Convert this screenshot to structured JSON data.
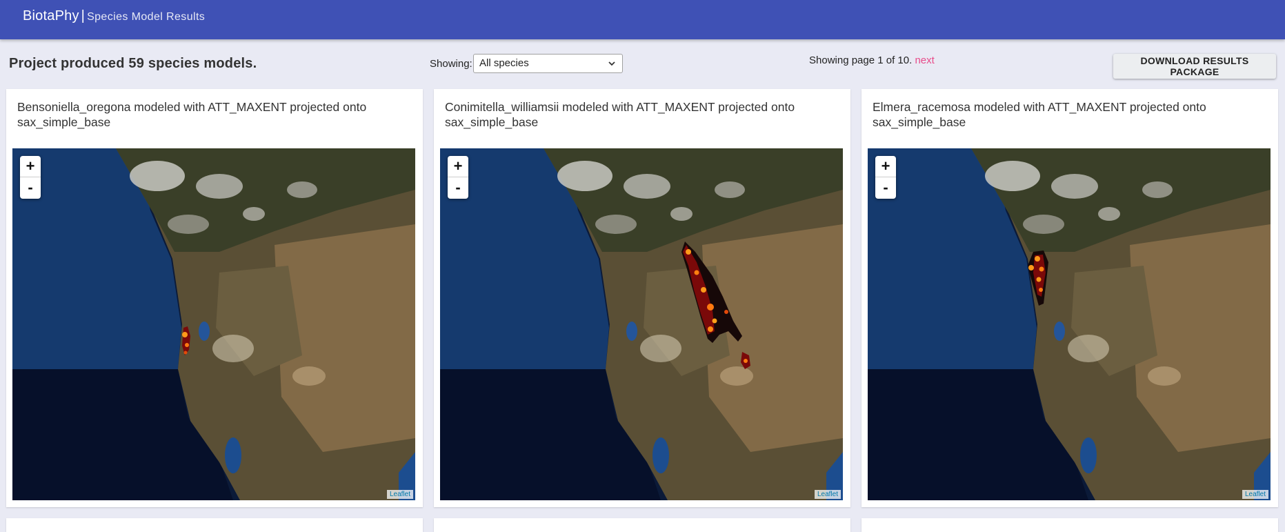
{
  "header": {
    "brand": "BiotaPhy",
    "separator": "|",
    "subtitle": "Species Model Results"
  },
  "toolbar": {
    "summary": "Project produced 59 species models.",
    "showing_label": "Showing:",
    "filter_selected": "All species",
    "pager_text": "Showing page 1 of 10.",
    "pager_next": "next",
    "download_label": "DOWNLOAD RESULTS PACKAGE"
  },
  "cards": [
    {
      "title": "Bensoniella_oregona modeled with ATT_MAXENT projected onto sax_simple_base"
    },
    {
      "title": "Conimitella_williamsii modeled with ATT_MAXENT projected onto sax_simple_base"
    },
    {
      "title": "Elmera_racemosa modeled with ATT_MAXENT projected onto sax_simple_base"
    }
  ],
  "map_controls": {
    "zoom_in": "+",
    "zoom_out": "-",
    "attribution": "Leaflet"
  },
  "colors": {
    "appbar": "#3f51b5",
    "next_link": "#e84c8a",
    "prediction_high": "#ff9a1a",
    "prediction_low": "#8a0a0a"
  },
  "icons": {
    "select_arrow": "chevron-down-icon"
  }
}
